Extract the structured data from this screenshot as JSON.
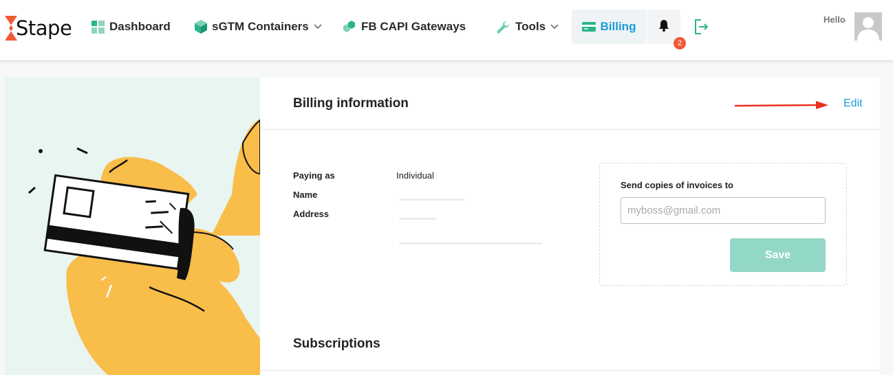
{
  "brand": {
    "name": "Stape",
    "accent": "#1a9bd7",
    "logo_mark_color": "#f05a36"
  },
  "nav": {
    "dashboard": "Dashboard",
    "sgtm": "sGTM Containers",
    "fbcapi": "FB CAPI Gateways",
    "tools": "Tools",
    "billing": "Billing",
    "notifications_count": "2"
  },
  "user": {
    "greeting": "Hello"
  },
  "billing": {
    "title": "Billing information",
    "edit_label": "Edit",
    "rows": [
      {
        "label": "Paying as",
        "value": "Individual"
      },
      {
        "label": "Name",
        "value": ""
      },
      {
        "label": "Address",
        "value": ""
      }
    ]
  },
  "invoices": {
    "label": "Send copies of invoices to",
    "placeholder": "myboss@gmail.com",
    "value": "",
    "save_label": "Save"
  },
  "subscriptions": {
    "title": "Subscriptions"
  },
  "icons": [
    "dashboard-icon",
    "cube-icon",
    "hexagons-icon",
    "wrench-icon",
    "card-icon",
    "bell-icon",
    "logout-icon",
    "chevron-down-icon"
  ]
}
